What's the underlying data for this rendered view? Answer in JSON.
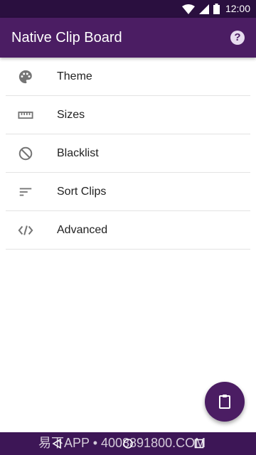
{
  "status_bar": {
    "time": "12:00",
    "icons": [
      "wifi-icon",
      "signal-icon",
      "battery-icon"
    ]
  },
  "app_bar": {
    "title": "Native Clip Board",
    "help_icon": "help-circle-icon",
    "help_glyph": "?"
  },
  "menu": {
    "items": [
      {
        "label": "Theme",
        "icon": "palette-icon"
      },
      {
        "label": "Sizes",
        "icon": "ruler-icon"
      },
      {
        "label": "Blacklist",
        "icon": "block-icon"
      },
      {
        "label": "Sort Clips",
        "icon": "sort-icon"
      },
      {
        "label": "Advanced",
        "icon": "code-icon"
      }
    ]
  },
  "fab": {
    "icon": "clipboard-icon"
  },
  "nav_bar": {
    "icons": [
      "back-icon",
      "home-icon",
      "recents-icon"
    ]
  },
  "watermark": {
    "text": "易下APP • 4008891800.COM"
  },
  "colors": {
    "status_bar": "#2a0f3f",
    "app_bar": "#4b1d63",
    "fab": "#4b1d63",
    "nav_bar": "#3d1656",
    "icon_gray": "#757575"
  }
}
